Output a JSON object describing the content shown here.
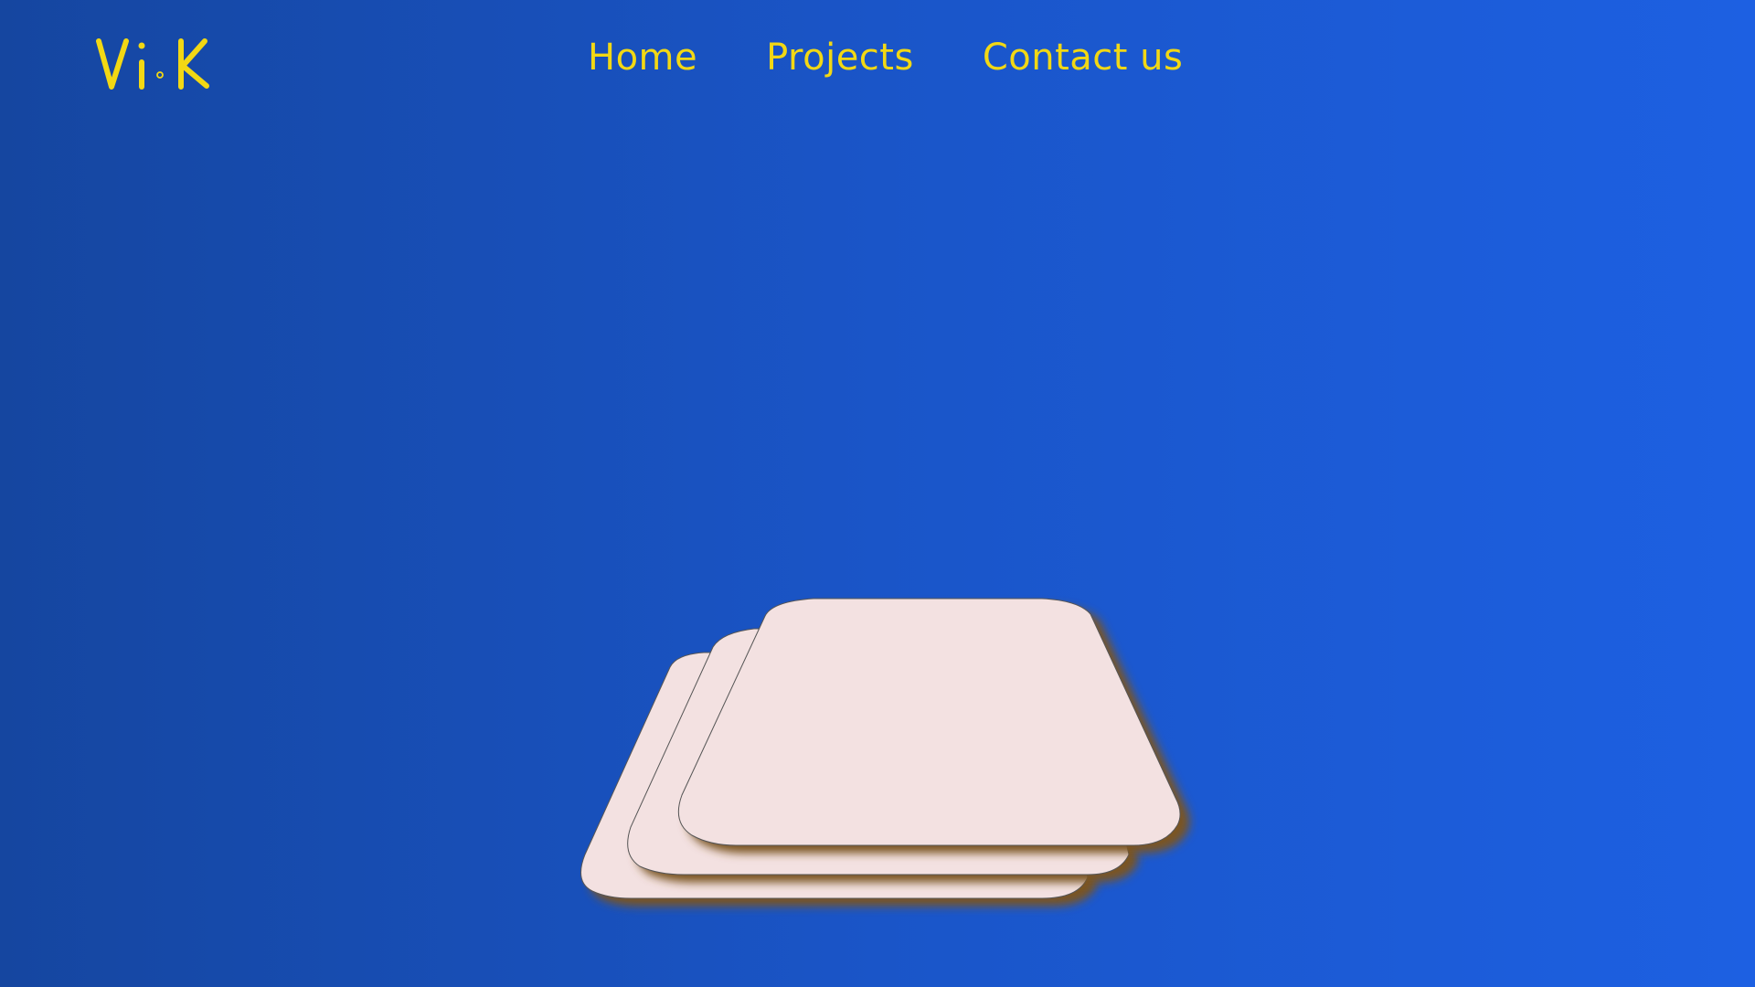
{
  "logo": {
    "text": "Vi.K"
  },
  "nav": {
    "items": [
      {
        "label": "Home"
      },
      {
        "label": "Projects"
      },
      {
        "label": "Contact us"
      }
    ]
  },
  "colors": {
    "accent": "#f2d814",
    "card": "#f3e1e1",
    "shadow": "#7a5520"
  }
}
